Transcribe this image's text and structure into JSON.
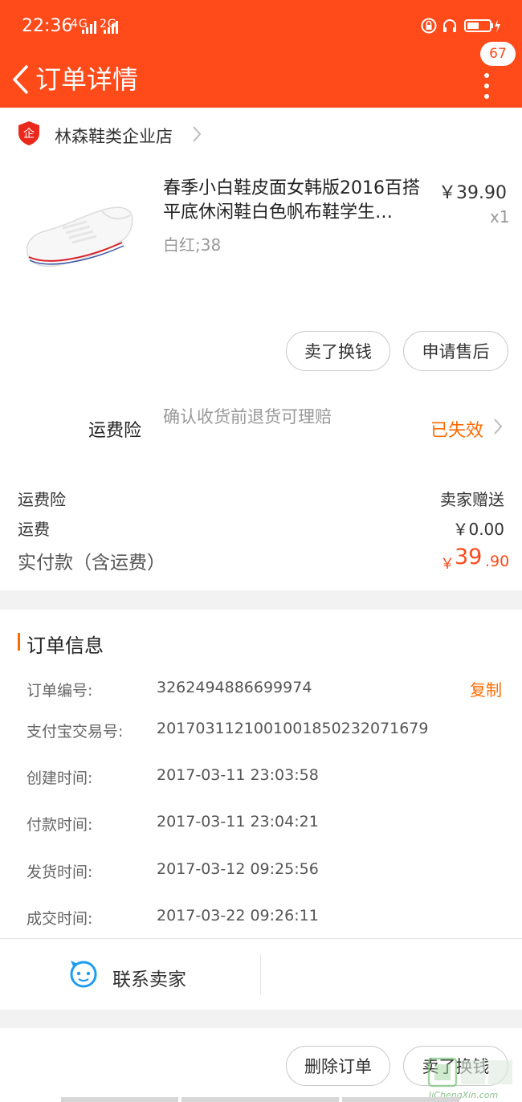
{
  "status_bar": {
    "time": "22:36",
    "signal_1": "4G",
    "signal_2": "2G"
  },
  "nav": {
    "title": "订单详情",
    "badge": "67",
    "back_icon": "chevron-left-icon",
    "more_icon": "more-vertical-icon"
  },
  "shop": {
    "name": "林森鞋类企业店",
    "icon": "enterprise-shield-icon"
  },
  "product": {
    "title": "春季小白鞋皮面女韩版2016百搭平底休闲鞋白色帆布鞋学生…",
    "sku": "白红;38",
    "price": "￥39.90",
    "qty": "x1"
  },
  "actions": {
    "sell_exchange": "卖了换钱",
    "after_sale": "申请售后"
  },
  "insurance": {
    "title": "运费险",
    "desc": "确认收货前退货可理赔",
    "status": "已失效"
  },
  "fees": {
    "ins_label": "运费险",
    "ins_value": "卖家赠送",
    "ship_label": "运费",
    "ship_value": "￥0.00",
    "total_label": "实付款（含运费）",
    "total_symbol": "￥",
    "total_int": "39",
    "total_dec": ".90"
  },
  "order_info": {
    "title": "订单信息",
    "copy_label": "复制",
    "rows": [
      {
        "label": "订单编号:",
        "value": "3262494886699974"
      },
      {
        "label": "支付宝交易号:",
        "value": "2017031121001001850232071679"
      },
      {
        "label": "创建时间:",
        "value": "2017-03-11 23:03:58"
      },
      {
        "label": "付款时间:",
        "value": "2017-03-11 23:04:21"
      },
      {
        "label": "发货时间:",
        "value": "2017-03-12 09:25:56"
      },
      {
        "label": "成交时间:",
        "value": "2017-03-22 09:26:11"
      }
    ]
  },
  "contact": {
    "label": "联系卖家",
    "icon": "chat-face-icon"
  },
  "bottom": {
    "delete_order": "删除订单",
    "sell_exchange": "卖了换钱"
  },
  "watermark": {
    "text": "JiChengXin.com"
  },
  "colors": {
    "brand": "#ff4a1a",
    "accent": "#ff6a00"
  }
}
